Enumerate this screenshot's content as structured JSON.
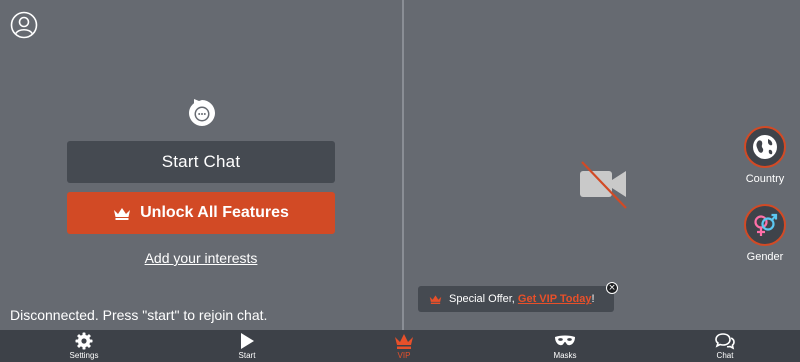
{
  "left_pane": {
    "start_chat_label": "Start Chat",
    "unlock_label": "Unlock All Features",
    "interests_link": "Add your interests",
    "status_text": "Disconnected. Press \"start\" to rejoin chat."
  },
  "right_pane": {
    "country_label": "Country",
    "gender_label": "Gender",
    "offer": {
      "prefix": "Special Offer, ",
      "link": "Get VIP Today",
      "suffix": "!",
      "close": "×"
    }
  },
  "bottom_nav": {
    "settings": "Settings",
    "start": "Start",
    "vip": "VIP",
    "masks": "Masks",
    "chat": "Chat"
  },
  "colors": {
    "background": "#666a71",
    "accent": "#d24a25",
    "dark_button": "#454a51",
    "bottom_bar": "#3d4148"
  },
  "icons": {
    "profile": "user-circle-icon",
    "logo": "chat-bubble-logo-icon",
    "crown": "crown-icon",
    "camera_off": "video-camera-off-icon",
    "country": "globe-icon",
    "gender": "gender-symbol-icon",
    "settings": "gear-icon",
    "start": "play-icon",
    "vip": "crown-icon",
    "masks": "mask-icon",
    "chat": "chat-bubbles-icon"
  }
}
